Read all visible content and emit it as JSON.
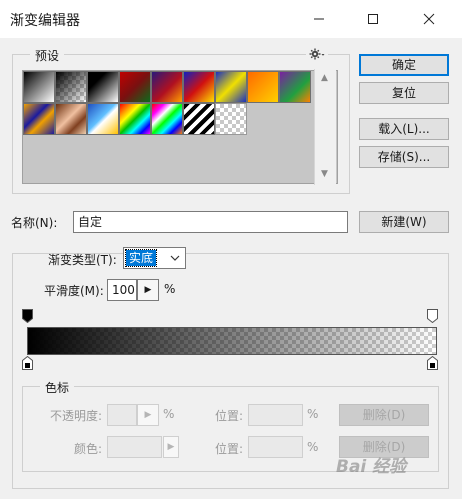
{
  "window": {
    "title": "渐变编辑器"
  },
  "presets": {
    "label": "预设",
    "settings_icon": "gear-icon"
  },
  "buttons": {
    "ok": "确定",
    "reset": "复位",
    "load": "载入(L)...",
    "save": "存储(S)...",
    "new": "新建(W)",
    "delete_opacity": "删除(D)",
    "delete_color": "删除(D)"
  },
  "name": {
    "label": "名称(N):",
    "value": "自定"
  },
  "gradient": {
    "type_label": "渐变类型(T):",
    "type_value": "实底",
    "smoothness_label": "平滑度(M):",
    "smoothness_value": "100",
    "smoothness_unit": "%",
    "start_color": "#000000",
    "start_opacity": 1.0,
    "end_opacity": 0.0
  },
  "stops": {
    "group_label": "色标",
    "opacity_label": "不透明度:",
    "opacity_unit": "%",
    "color_label": "颜色:",
    "location_label": "位置:",
    "location_unit": "%"
  },
  "watermark": "Bai 经验"
}
